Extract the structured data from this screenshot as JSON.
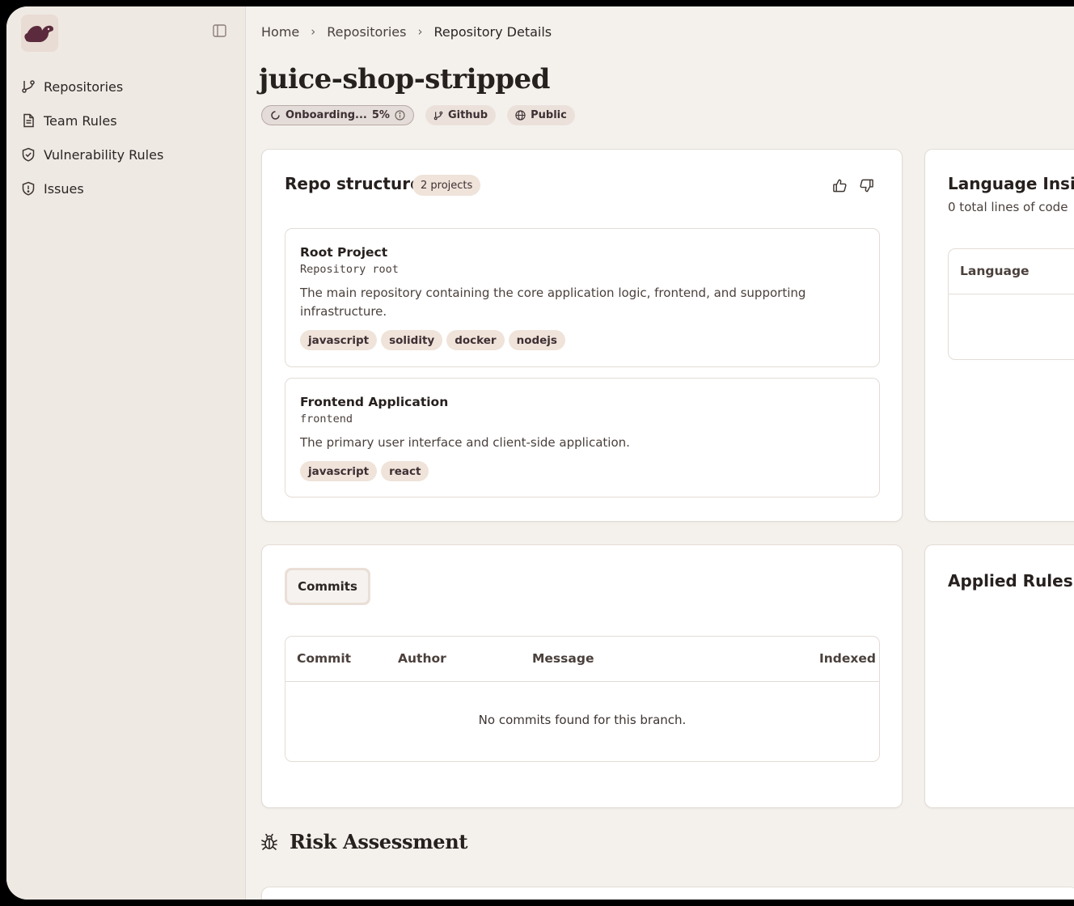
{
  "sidebar": {
    "items": [
      {
        "label": "Repositories",
        "icon": "git-branch-icon"
      },
      {
        "label": "Team Rules",
        "icon": "document-icon"
      },
      {
        "label": "Vulnerability Rules",
        "icon": "shield-check-icon"
      },
      {
        "label": "Issues",
        "icon": "shield-alert-icon"
      }
    ]
  },
  "breadcrumb": {
    "items": [
      "Home",
      "Repositories",
      "Repository Details"
    ]
  },
  "repo": {
    "name": "juice-shop-stripped",
    "status_label": "Onboarding...",
    "progress": "5%",
    "provider": "Github",
    "visibility": "Public"
  },
  "repo_structure": {
    "title": "Repo structure",
    "count_label": "2 projects",
    "projects": [
      {
        "name": "Root Project",
        "path": "Repository root",
        "description": "The main repository containing the core application logic, frontend, and supporting infrastructure.",
        "tags": [
          "javascript",
          "solidity",
          "docker",
          "nodejs"
        ]
      },
      {
        "name": "Frontend Application",
        "path": "frontend",
        "description": "The primary user interface and client-side application.",
        "tags": [
          "javascript",
          "react"
        ]
      }
    ]
  },
  "language_insights": {
    "title": "Language Insig",
    "subtitle": "0 total lines of code",
    "column": "Language"
  },
  "commits": {
    "tab_label": "Commits",
    "columns": [
      "Commit",
      "Author",
      "Message",
      "Indexed"
    ],
    "empty_text": "No commits found for this branch."
  },
  "applied_rules": {
    "title": "Applied Rules"
  },
  "risk": {
    "title": "Risk Assessment"
  },
  "colors": {
    "accent": "#5b2a3c",
    "background": "#f4f1ed",
    "sidebar": "#efe9e4",
    "pill": "#efe3da"
  }
}
